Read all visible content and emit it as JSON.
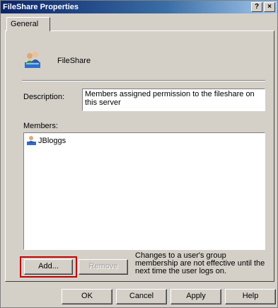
{
  "window": {
    "title": "FileShare Properties",
    "help_button": "?",
    "close_button": "×"
  },
  "tabs": [
    {
      "label": "General"
    }
  ],
  "group": {
    "icon": "user-group-icon",
    "name": "FileShare"
  },
  "description": {
    "label": "Description:",
    "value": "Members assigned permission to the fileshare on this server"
  },
  "members": {
    "label": "Members:",
    "items": [
      {
        "name": "JBloggs",
        "icon": "user-icon"
      }
    ]
  },
  "buttons": {
    "add": "Add...",
    "remove": "Remove",
    "ok": "OK",
    "cancel": "Cancel",
    "apply": "Apply",
    "help": "Help"
  },
  "note": "Changes to a user's group membership are not effective until the next time the user logs on.",
  "colors": {
    "titlebar_start": "#0a246a",
    "titlebar_end": "#a6caf0",
    "face": "#d4d0c8",
    "highlight_border": "#c00000"
  }
}
